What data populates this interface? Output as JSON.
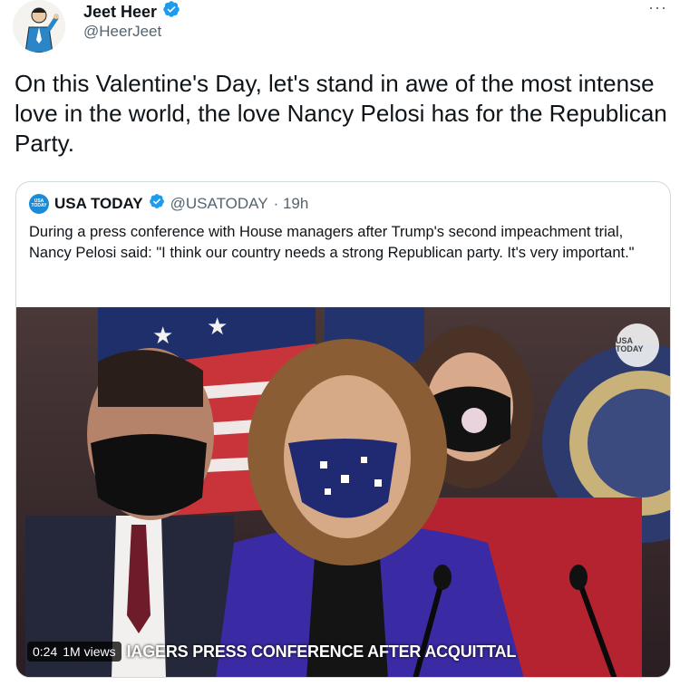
{
  "author": {
    "display_name": "Jeet Heer",
    "handle": "@HeerJeet",
    "verified": true
  },
  "more_icon": "more-horizontal-icon",
  "tweet": {
    "text": "On this Valentine's Day, let's stand in awe of the most intense love in the world, the love Nancy Pelosi has for the Republican Party."
  },
  "quoted": {
    "name": "USA TODAY",
    "handle": "@USATODAY",
    "time": "· 19h",
    "verified": true,
    "text": "During a press conference with House managers after Trump's second impeachment trial, Nancy Pelosi said: \"I think our country needs a strong Republican party. It's very important.\"",
    "logo_text": "USA TODAY",
    "video": {
      "elapsed": "0:24",
      "views": "1M views",
      "caption": "IAGERS PRESS CONFERENCE AFTER ACQUITTAL",
      "watermark": "USA TODAY"
    }
  },
  "colors": {
    "verified": "#1d9bf0",
    "text_secondary": "#536471",
    "usa_today_blue": "#1a8bd6"
  }
}
